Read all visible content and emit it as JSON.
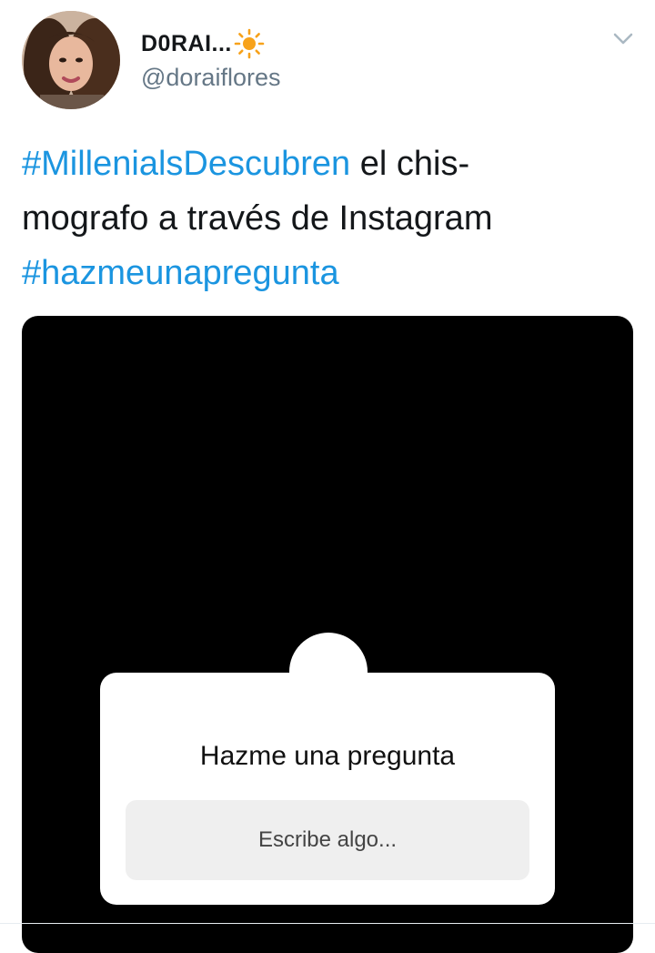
{
  "user": {
    "display_name": "D0RAI...",
    "handle": "@doraiflores",
    "name_emoji_icon": "sun-icon"
  },
  "tweet": {
    "segments": [
      {
        "text": "#MillenialsDescubren",
        "type": "hashtag"
      },
      {
        "text": " el chis-",
        "type": "text"
      },
      {
        "text": "mografo a través de Instagram",
        "type": "text"
      },
      {
        "text": "#hazmeunapregunta",
        "type": "hashtag"
      }
    ]
  },
  "media": {
    "sticker_title": "Hazme una pregunta",
    "input_placeholder": "Escribe algo..."
  },
  "colors": {
    "hashtag": "#1b95e0",
    "handle": "#657786",
    "text": "#14171a",
    "media_bg": "#000000",
    "input_bg": "#efefef",
    "sun": "#f7a21b"
  },
  "icons": {
    "menu": "chevron-down-icon"
  }
}
